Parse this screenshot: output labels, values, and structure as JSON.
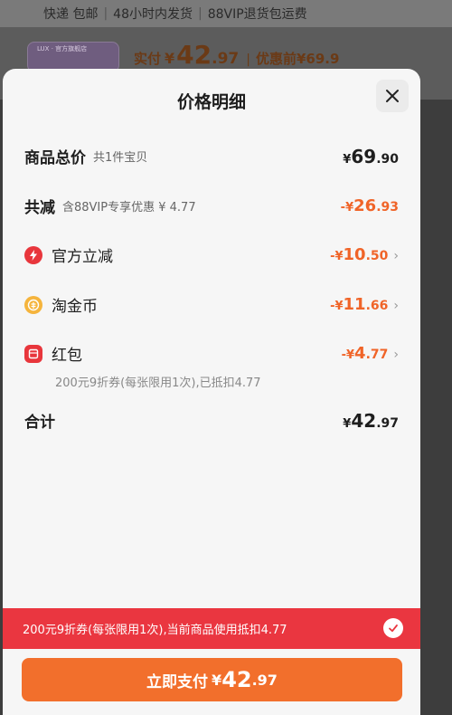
{
  "background": {
    "shipping": [
      "快递 包邮",
      "48小时内发货",
      "88VIP退货包运费"
    ],
    "thumb_label": "LUX · 官方旗舰店",
    "paid_label": "实付",
    "paid_currency": "¥",
    "paid_int": "42",
    "paid_dec": ".97",
    "before_label": "优惠前¥69.9"
  },
  "sheet": {
    "title": "价格明细",
    "close_icon": "close-icon"
  },
  "rows": {
    "total": {
      "label": "商品总价",
      "sub": "共1件宝贝",
      "cur": "¥",
      "int": "69",
      "dec": ".90"
    },
    "reduce": {
      "label": "共减",
      "sub": "含88VIP专享优惠 ¥ 4.77",
      "cur": "-¥",
      "int": "26",
      "dec": ".93"
    },
    "official": {
      "label": "官方立减",
      "cur": "-¥",
      "int": "10",
      "dec": ".50",
      "icon": "lightning-icon"
    },
    "coin": {
      "label": "淘金币",
      "cur": "-¥",
      "int": "11",
      "dec": ".66",
      "icon": "coin-icon"
    },
    "redpacket": {
      "label": "红包",
      "cur": "-¥",
      "int": "4",
      "dec": ".77",
      "icon": "red-packet-icon",
      "note": "200元9折券(每张限用1次),已抵扣4.77"
    },
    "sum": {
      "label": "合计",
      "cur": "¥",
      "int": "42",
      "dec": ".97"
    }
  },
  "footer": {
    "coupon_text": "200元9折券(每张限用1次),当前商品使用抵扣4.77",
    "pay_label": "立即支付",
    "pay_cur": "¥",
    "pay_int": "42",
    "pay_dec": ".97"
  },
  "colors": {
    "accent": "#f06428",
    "red": "#ea3640",
    "pay": "#f26f2c"
  }
}
